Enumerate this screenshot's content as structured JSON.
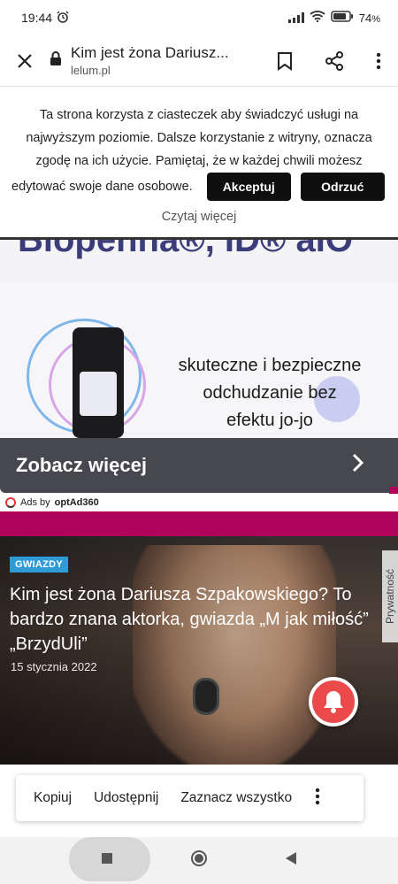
{
  "status_bar": {
    "time": "19:44",
    "battery": "74",
    "battery_unit": "%"
  },
  "browser": {
    "page_title": "Kim jest żona Dariusz...",
    "domain": "lelum.pl",
    "icons": [
      "close-icon",
      "lock-icon",
      "bookmark-icon",
      "share-icon",
      "more-vert-icon"
    ]
  },
  "cookie_banner": {
    "line1": "Ta strona korzysta z ciasteczek aby świadczyć usługi na",
    "line2": "najwyższym poziomie. Dalsze korzystanie z witryny, oznacza",
    "line3": "zgodę na ich użycie. Pamiętaj, że w każdej chwili możesz",
    "line4": "edytować swoje dane osobowe.",
    "accept_label": "Akceptuj",
    "refuse_label": "Odrzuć",
    "more_label": "Czytaj więcej"
  },
  "partial_heading": "Biopenna®, ID® aIO",
  "ad": {
    "slogan_line1": "skuteczne i bezpieczne",
    "slogan_line2": "odchudzanie bez",
    "slogan_line3": "efektu jo-jo",
    "cta_label": "Zobacz więcej",
    "ads_by": "Ads by",
    "ads_network": "optAd360"
  },
  "article": {
    "tag": "GWIAZDY",
    "headline": "Kim jest żona Dariusza Szpakowskiego? To bardzo znana aktorka, gwiazda „M jak miłość” „BrzydUli”",
    "date": "15 stycznia 2022",
    "privacy_label": "Prywatność"
  },
  "selection_popup": {
    "copy": "Kopiuj",
    "share": "Udostępnij",
    "select_all": "Zaznacz wszystko"
  },
  "colors": {
    "accent_magenta": "#b0045c",
    "tag_blue": "#2f9bd6",
    "bell_red": "#ea4a4a"
  }
}
